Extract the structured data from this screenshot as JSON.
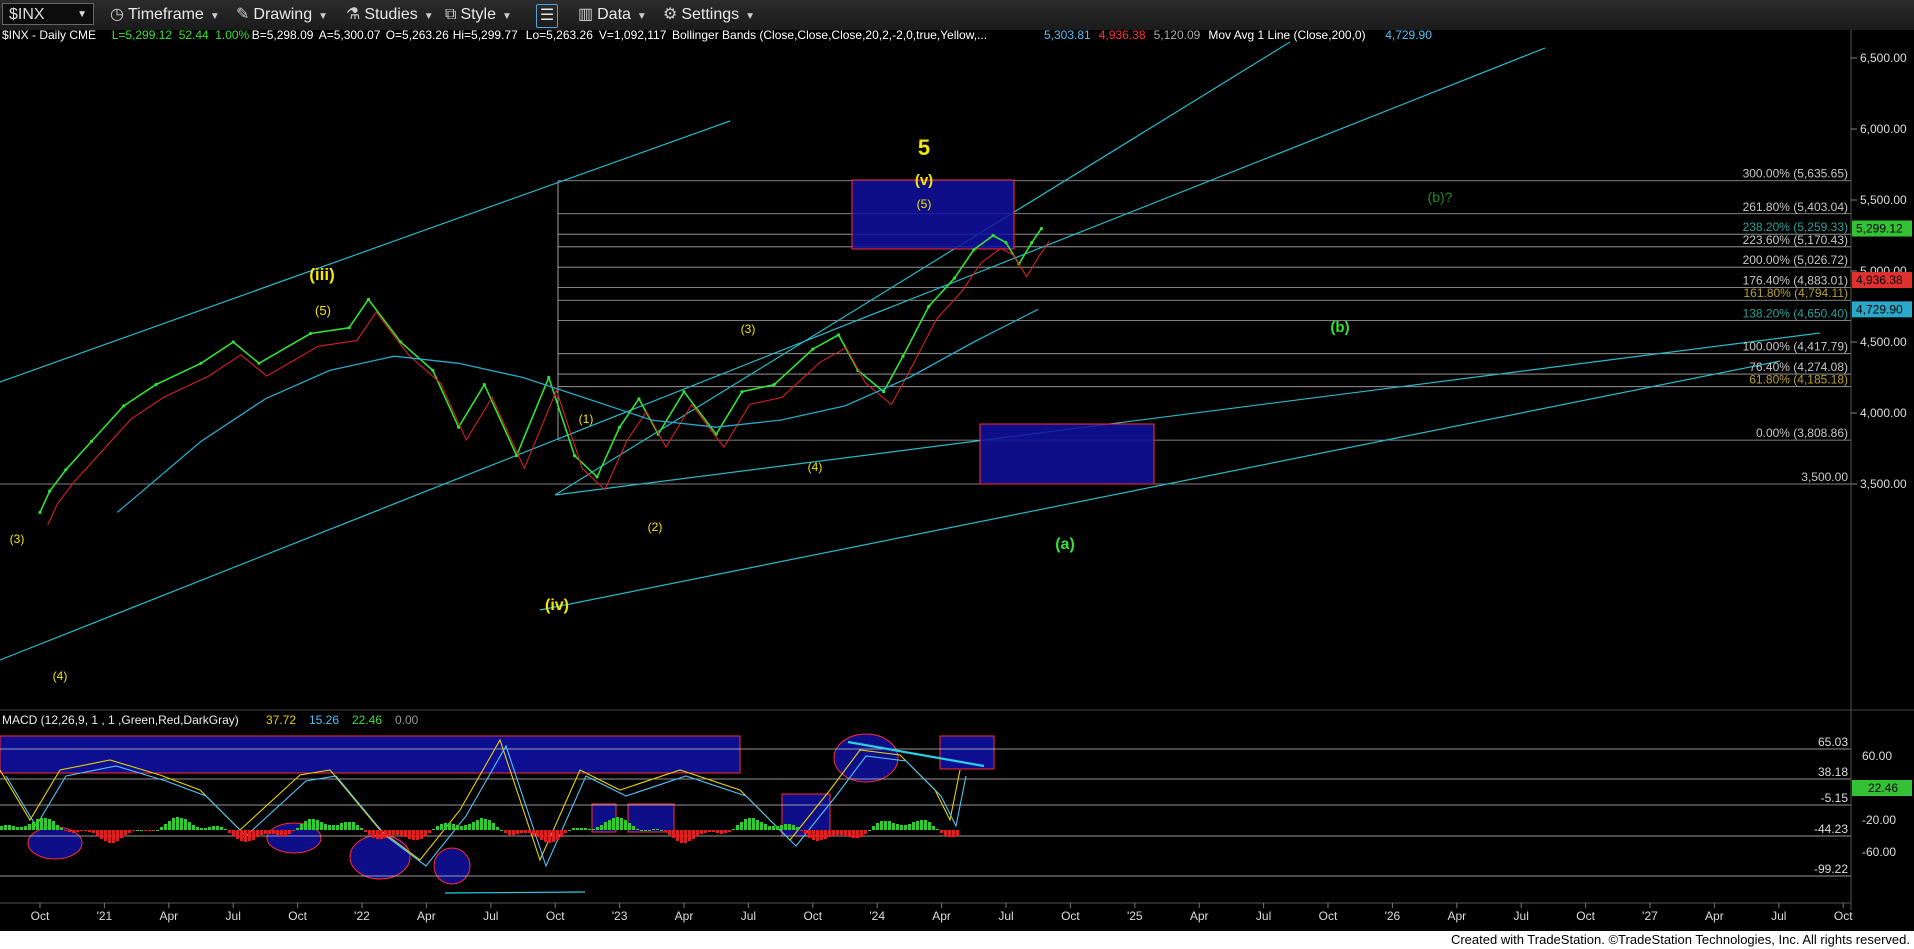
{
  "toolbar": {
    "symbol": "$INX",
    "timeframe": "Timeframe",
    "drawing": "Drawing",
    "studies": "Studies",
    "style": "Style",
    "data": "Data",
    "settings": "Settings"
  },
  "header": {
    "segments": [
      {
        "text": "$INX - Daily  CME",
        "color": "#ffffff"
      },
      {
        "text": "L=5,299.12",
        "color": "#34e234"
      },
      {
        "text": "52.44",
        "color": "#34e234"
      },
      {
        "text": "1.00%",
        "color": "#34e234"
      },
      {
        "text": "B=5,298.09",
        "color": "#ffffff"
      },
      {
        "text": "A=5,300.07",
        "color": "#ffffff"
      },
      {
        "text": "O=5,263.26",
        "color": "#ffffff"
      },
      {
        "text": "Hi=5,299.77",
        "color": "#ffffff"
      },
      {
        "text": "Lo=5,263.26",
        "color": "#ffffff"
      },
      {
        "text": "V=1,092,117",
        "color": "#ffffff"
      },
      {
        "text": "Bollinger Bands (Close,Close,Close,20,2,-2,0,true,Yellow,...",
        "color": "#ffffff"
      },
      {
        "text": "5,303.81",
        "color": "#4fc3f7"
      },
      {
        "text": "4,936.38",
        "color": "#ff3030"
      },
      {
        "text": "5,120.09",
        "color": "#aaaaaa"
      },
      {
        "text": "Mov Avg 1 Line (Close,200,0)",
        "color": "#ffffff"
      },
      {
        "text": "4,729.90",
        "color": "#4fc3f7"
      }
    ]
  },
  "fib_labels": [
    {
      "text": "300.00% (5,635.65)",
      "value": 5635.65,
      "color": "#c8c8c8"
    },
    {
      "text": "261.80% (5,403.04)",
      "value": 5403.04,
      "color": "#c8c8c8"
    },
    {
      "text": "238.20% (5,259.33)",
      "value": 5259.33,
      "color": "#2aa198"
    },
    {
      "text": "223.60% (5,170.43)",
      "value": 5170.43,
      "color": "#c8c8c8"
    },
    {
      "text": "200.00% (5,026.72)",
      "value": 5026.72,
      "color": "#c8c8c8"
    },
    {
      "text": "176.40% (4,883.01)",
      "value": 4883.01,
      "color": "#c8c8c8"
    },
    {
      "text": "161.80% (4,794.11)",
      "value": 4794.11,
      "color": "#b8a030"
    },
    {
      "text": "138.20% (4,650.40)",
      "value": 4650.4,
      "color": "#2aa198"
    },
    {
      "text": "100.00% (4,417.79)",
      "value": 4417.79,
      "color": "#c8c8c8"
    },
    {
      "text": "76.40% (4,274.08)",
      "value": 4274.08,
      "color": "#c8c8c8"
    },
    {
      "text": "61.80% (4,185.18)",
      "value": 4185.18,
      "color": "#b8a030"
    },
    {
      "text": "0.00% (3,808.86)",
      "value": 3808.86,
      "color": "#c8c8c8"
    },
    {
      "text": "3,500.00",
      "value": 3500,
      "color": "#c8c8c8"
    }
  ],
  "wave_labels": [
    {
      "text": "5",
      "color": "#f2e600",
      "big": true
    },
    {
      "text": "(v)",
      "color": "#f2e600",
      "big": false
    },
    {
      "text": "(iii)",
      "color": "#f2e600",
      "big": false
    },
    {
      "text": "(iv)",
      "color": "#f2e600",
      "big": false
    },
    {
      "text": "(5)",
      "color": "#f2e600"
    },
    {
      "text": "(5)",
      "color": "#f2e600"
    },
    {
      "text": "(3)",
      "color": "#f2e600"
    },
    {
      "text": "(3)",
      "color": "#f2e600"
    },
    {
      "text": "(4)",
      "color": "#f2e600"
    },
    {
      "text": "(4)",
      "color": "#f2e600"
    },
    {
      "text": "(1)",
      "color": "#f2e600"
    },
    {
      "text": "(2)",
      "color": "#f2e600"
    },
    {
      "text": "(b)?",
      "color": "#1e8c1e"
    },
    {
      "text": "(b)",
      "color": "#34e234"
    },
    {
      "text": "(a)",
      "color": "#34e234"
    }
  ],
  "badges": [
    {
      "text": "5,299.12",
      "bg": "#34c234",
      "fg": "#000"
    },
    {
      "text": "4,936.38",
      "bg": "#e03030",
      "fg": "#000"
    },
    {
      "text": "4,729.90",
      "bg": "#2aa8c8",
      "fg": "#000"
    },
    {
      "text": "22.46",
      "bg": "#34c234",
      "fg": "#000"
    }
  ],
  "macd": {
    "title": "MACD (12,26,9, 1 , 1 ,Green,Red,DarkGray)",
    "values": [
      {
        "text": "37.72",
        "color": "#e6d200"
      },
      {
        "text": "15.26",
        "color": "#4fc3f7"
      },
      {
        "text": "22.46",
        "color": "#34e234"
      },
      {
        "text": "0.00",
        "color": "#999999"
      }
    ],
    "levels": [
      "65.03",
      "38.18",
      "-5.15",
      "-44.23",
      "-99.22"
    ],
    "axis_ticks": [
      "60.00",
      "-20.00",
      "-60.00"
    ]
  },
  "chart_data": {
    "type": "line",
    "price_axis_ticks": [
      "6,500.00",
      "6,000.00",
      "5,500.00",
      "5,000.00",
      "4,500.00",
      "4,000.00",
      "3,500.00"
    ],
    "time_axis_ticks": [
      "Oct",
      "'21",
      "Apr",
      "Jul",
      "Oct",
      "'22",
      "Apr",
      "Jul",
      "Oct",
      "'23",
      "Apr",
      "Jul",
      "Oct",
      "'24",
      "Apr",
      "Jul",
      "Oct",
      "'25",
      "Apr",
      "Jul",
      "Oct",
      "'26",
      "Apr",
      "Jul",
      "Oct",
      "'27",
      "Apr",
      "Jul",
      "Oct"
    ],
    "ylim": [
      2600,
      6700
    ],
    "series": [
      {
        "type": "price",
        "color": "#34e234",
        "points": [
          [
            0,
            3300
          ],
          [
            0.15,
            3450
          ],
          [
            0.4,
            3600
          ],
          [
            0.8,
            3800
          ],
          [
            1.3,
            4050
          ],
          [
            1.8,
            4200
          ],
          [
            2.5,
            4350
          ],
          [
            3,
            4500
          ],
          [
            3.4,
            4350
          ],
          [
            4.2,
            4560
          ],
          [
            4.8,
            4600
          ],
          [
            5.1,
            4800
          ],
          [
            5.6,
            4500
          ],
          [
            6.1,
            4300
          ],
          [
            6.5,
            3900
          ],
          [
            6.9,
            4200
          ],
          [
            7.4,
            3700
          ],
          [
            7.9,
            4250
          ],
          [
            8.3,
            3700
          ],
          [
            8.65,
            3550
          ],
          [
            9.0,
            3900
          ],
          [
            9.3,
            4100
          ],
          [
            9.6,
            3850
          ],
          [
            10.0,
            4150
          ],
          [
            10.5,
            3850
          ],
          [
            10.9,
            4150
          ],
          [
            11.4,
            4200
          ],
          [
            12.0,
            4450
          ],
          [
            12.4,
            4550
          ],
          [
            12.7,
            4300
          ],
          [
            13.1,
            4150
          ],
          [
            13.4,
            4400
          ],
          [
            13.8,
            4750
          ],
          [
            14.2,
            4950
          ],
          [
            14.5,
            5150
          ],
          [
            14.8,
            5250
          ],
          [
            15.0,
            5200
          ],
          [
            15.2,
            5050
          ],
          [
            15.4,
            5200
          ],
          [
            15.55,
            5299
          ]
        ]
      },
      {
        "type": "ma200",
        "color": "#2aa8c8",
        "points": [
          [
            1.2,
            3300
          ],
          [
            2.5,
            3800
          ],
          [
            3.5,
            4100
          ],
          [
            4.5,
            4300
          ],
          [
            5.5,
            4400
          ],
          [
            6.5,
            4350
          ],
          [
            7.5,
            4250
          ],
          [
            8.5,
            4100
          ],
          [
            9.5,
            3950
          ],
          [
            10.5,
            3900
          ],
          [
            11.5,
            3950
          ],
          [
            12.5,
            4050
          ],
          [
            13.5,
            4250
          ],
          [
            14.5,
            4500
          ],
          [
            15.5,
            4730
          ]
        ]
      }
    ]
  }
}
